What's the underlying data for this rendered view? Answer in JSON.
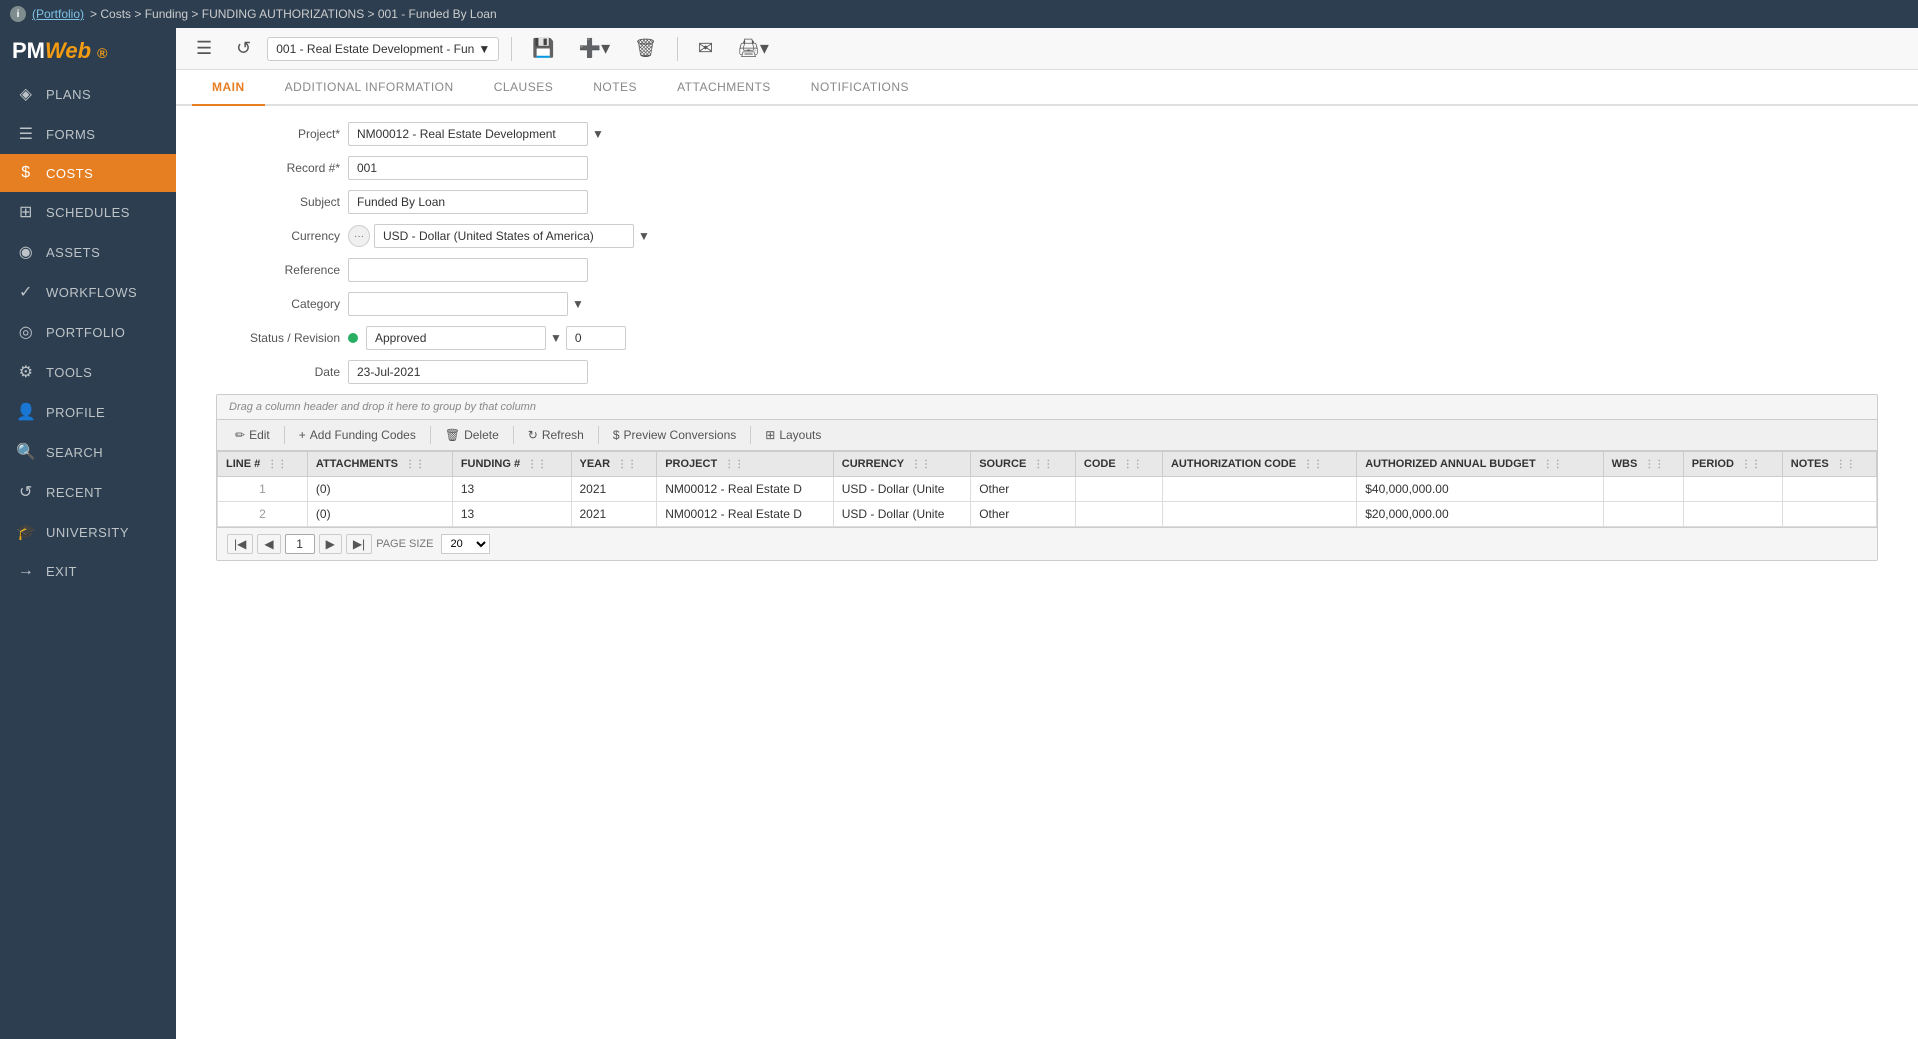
{
  "topbar": {
    "info_title": "i",
    "breadcrumb": "(Portfolio) > Costs > Funding > FUNDING AUTHORIZATIONS > 001 - Funded By Loan",
    "portfolio_link": "(Portfolio)",
    "path": " > Costs > Funding > FUNDING AUTHORIZATIONS > 001 - Funded By Loan"
  },
  "toolbar": {
    "record_dropdown_value": "001 - Real Estate Development - Fun",
    "save_label": "💾",
    "add_label": "➕",
    "delete_label": "🗑",
    "email_label": "✉",
    "print_label": "🖨"
  },
  "tabs": {
    "items": [
      {
        "label": "MAIN",
        "active": true
      },
      {
        "label": "ADDITIONAL INFORMATION",
        "active": false
      },
      {
        "label": "CLAUSES",
        "active": false
      },
      {
        "label": "NOTES",
        "active": false
      },
      {
        "label": "ATTACHMENTS",
        "active": false
      },
      {
        "label": "NOTIFICATIONS",
        "active": false
      }
    ]
  },
  "form": {
    "project_label": "Project*",
    "project_value": "NM00012 - Real Estate Development",
    "record_label": "Record #*",
    "record_value": "001",
    "subject_label": "Subject",
    "subject_value": "Funded By Loan",
    "currency_label": "Currency",
    "currency_value": "USD - Dollar (United States of America)",
    "reference_label": "Reference",
    "reference_value": "",
    "category_label": "Category",
    "category_value": "",
    "status_label": "Status / Revision",
    "status_value": "Approved",
    "revision_value": "0",
    "date_label": "Date",
    "date_value": "23-Jul-2021"
  },
  "grid": {
    "drag_hint": "Drag a column header and drop it here to group by that column",
    "toolbar": {
      "edit_label": "Edit",
      "add_funding_label": "Add Funding Codes",
      "delete_label": "Delete",
      "refresh_label": "Refresh",
      "preview_label": "Preview Conversions",
      "layouts_label": "Layouts"
    },
    "columns": [
      {
        "label": "LINE #"
      },
      {
        "label": "ATTACHMENTS"
      },
      {
        "label": "FUNDING #"
      },
      {
        "label": "YEAR"
      },
      {
        "label": "PROJECT"
      },
      {
        "label": "CURRENCY"
      },
      {
        "label": "SOURCE"
      },
      {
        "label": "CODE"
      },
      {
        "label": "AUTHORIZATION CODE"
      },
      {
        "label": "AUTHORIZED ANNUAL BUDGET"
      },
      {
        "label": "WBS"
      },
      {
        "label": "PERIOD"
      },
      {
        "label": "NOTES"
      }
    ],
    "rows": [
      {
        "line": "1",
        "attachments": "(0)",
        "funding_num": "13",
        "year": "2021",
        "project": "NM00012 - Real Estate D",
        "currency": "USD - Dollar (Unite",
        "source": "Other",
        "code": "",
        "auth_code": "",
        "authorized_annual_budget": "$40,000,000.00",
        "wbs": "",
        "period": "",
        "notes": ""
      },
      {
        "line": "2",
        "attachments": "(0)",
        "funding_num": "13",
        "year": "2021",
        "project": "NM00012 - Real Estate D",
        "currency": "USD - Dollar (Unite",
        "source": "Other",
        "code": "",
        "auth_code": "",
        "authorized_annual_budget": "$20,000,000.00",
        "wbs": "",
        "period": "",
        "notes": ""
      }
    ],
    "pagination": {
      "page_size_label": "PAGE SIZE",
      "page_size_value": "20",
      "current_page": "1"
    }
  },
  "sidebar": {
    "logo_main": "PM",
    "logo_accent": "Web",
    "items": [
      {
        "label": "PLANS",
        "icon": "◈",
        "active": false
      },
      {
        "label": "FORMS",
        "icon": "☰",
        "active": false
      },
      {
        "label": "COSTS",
        "icon": "$",
        "active": true
      },
      {
        "label": "SCHEDULES",
        "icon": "⊞",
        "active": false
      },
      {
        "label": "ASSETS",
        "icon": "◉",
        "active": false
      },
      {
        "label": "WORKFLOWS",
        "icon": "✓",
        "active": false
      },
      {
        "label": "PORTFOLIO",
        "icon": "◎",
        "active": false
      },
      {
        "label": "TOOLS",
        "icon": "⚙",
        "active": false
      },
      {
        "label": "PROFILE",
        "icon": "👤",
        "active": false
      },
      {
        "label": "SEARCH",
        "icon": "🔍",
        "active": false
      },
      {
        "label": "RECENT",
        "icon": "↺",
        "active": false
      },
      {
        "label": "UNIVERSITY",
        "icon": "🎓",
        "active": false
      },
      {
        "label": "EXIT",
        "icon": "→",
        "active": false
      }
    ]
  }
}
